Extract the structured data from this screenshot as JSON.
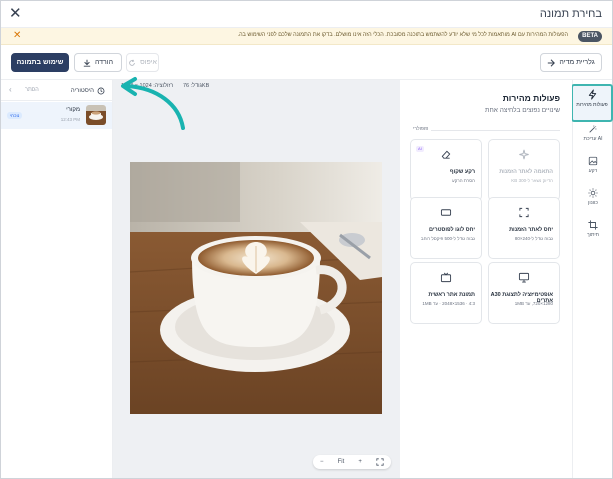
{
  "window": {
    "title": "בחירת תמונה",
    "close_icon": "close-icon"
  },
  "banner": {
    "badge": "BETA",
    "message": "הפעולות המהירות עם AI מותאמות לכל מי שלא יודע להשתמש בתוכנה מסובכת. הכלי הזה אינו מושלם. בדקו את התמונה שלכם לפני השימוש בה.",
    "dismiss_icon": "close-icon",
    "accent": "#d97706"
  },
  "toolbar": {
    "guide_label": "גלריית מדיה",
    "reset_label": "איפוס",
    "download_label": "הורדה",
    "use_label": "שימוש בתמונה",
    "primary_color": "#2c3e63"
  },
  "rail": {
    "items": [
      {
        "label": "פעולות מהירות",
        "icon": "lightning-icon"
      },
      {
        "label": "עריכת AI",
        "icon": "magic-wand-icon"
      },
      {
        "label": "רקע",
        "icon": "image-icon"
      },
      {
        "label": "כוונון",
        "icon": "sun-icon"
      },
      {
        "label": "חיתוך",
        "icon": "crop-icon"
      }
    ],
    "active_color": "#3fb5b0"
  },
  "quick": {
    "title": "פעולות מהירות",
    "subtitle": "שינויים נפוצים בלחיצה אחת",
    "section": "פופולרי",
    "cards": [
      {
        "title": "התאמה לאתר הזמנות",
        "desc": "הדיוק נשאר ל-300 KB",
        "icon": "sparkle-icon",
        "muted": true,
        "ai": false
      },
      {
        "title": "רקע שקוף",
        "desc": "הסרת הרקע",
        "icon": "eraser-icon",
        "muted": false,
        "ai": true,
        "ai_label": "AI"
      },
      {
        "title": "יחס לאתר הזמנות",
        "desc": "גבוה גודל ל-240×80",
        "icon": "expand-icon",
        "muted": false,
        "ai": false
      },
      {
        "title": "יחס לוגו לפוסטרים",
        "desc": "גבוה גודל ל-500 פיקסל רוחב",
        "icon": "rectangle-icon",
        "muted": false,
        "ai": false
      },
      {
        "title": "אופטימיזציה לתצוגת A30 אתרים",
        "desc": "1280×720, עד 1MB",
        "icon": "monitor-icon",
        "muted": false,
        "ai": false
      },
      {
        "title": "תמונת אתר ראשית",
        "desc": "4:3 · 1536×2048 · עד 1MB",
        "icon": "tv-icon",
        "muted": false,
        "ai": false
      }
    ]
  },
  "canvas": {
    "size_text": "גודל: 76KB",
    "dims_text": "רזולוציה: 1024 × 1024",
    "zoom_fit": "Fit",
    "zoom_in": "+",
    "zoom_out": "−",
    "fullscreen_icon": "fullscreen-icon",
    "background": "#eef0f3"
  },
  "history": {
    "title": "היסטוריה",
    "hide_label": "הסתר",
    "items": [
      {
        "name": "מקורי",
        "time": "12:43 PM",
        "badge": "נוכחי"
      }
    ]
  },
  "annotation": {
    "arrow_color": "#19b3b0"
  }
}
